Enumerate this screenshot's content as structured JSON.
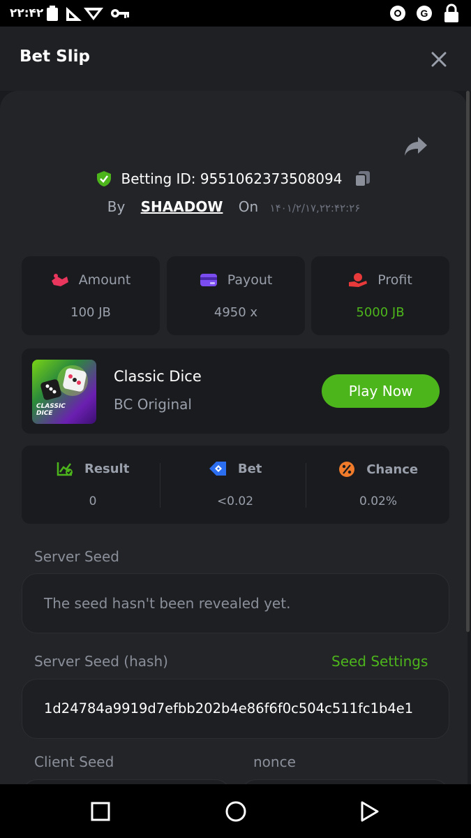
{
  "status_bar": {
    "time": "۲۲:۴۲"
  },
  "header": {
    "title": "Bet Slip"
  },
  "bet": {
    "id_label": "Betting ID: 9551062373508094",
    "by_label": "By",
    "username": "SHAADOW",
    "on_label": "On",
    "date": "۱۴۰۱/۲/۱۷,۲۲:۴۲:۲۶"
  },
  "stats": [
    {
      "label": "Amount",
      "value": "100 JB",
      "icon": "amount-icon",
      "value_color": "#9aa0ab"
    },
    {
      "label": "Payout",
      "value": "4950 x",
      "icon": "payout-icon",
      "value_color": "#9aa0ab"
    },
    {
      "label": "Profit",
      "value": "5000 JB",
      "icon": "profit-icon",
      "value_color": "#4db51c"
    }
  ],
  "game": {
    "thumb_text": "CLASSIC DICE",
    "name": "Classic Dice",
    "provider": "BC Original",
    "play_label": "Play Now"
  },
  "result_row": [
    {
      "label": "Result",
      "value": "0",
      "icon": "result-icon"
    },
    {
      "label": "Bet",
      "value": "<0.02",
      "icon": "bet-icon"
    },
    {
      "label": "Chance",
      "value": "0.02%",
      "icon": "chance-icon"
    }
  ],
  "seeds": {
    "server_seed_label": "Server Seed",
    "server_seed_value": "The seed hasn't been revealed yet.",
    "server_hash_label": "Server Seed (hash)",
    "seed_settings_label": "Seed Settings",
    "server_hash_value": "1d24784a9919d7efbb202b4e86f6f0c504c511fc1b4e1",
    "client_seed_label": "Client Seed",
    "nonce_label": "nonce"
  },
  "colors": {
    "accent_green": "#4db51c",
    "background": "#1a1b1e",
    "panel": "#232428"
  }
}
